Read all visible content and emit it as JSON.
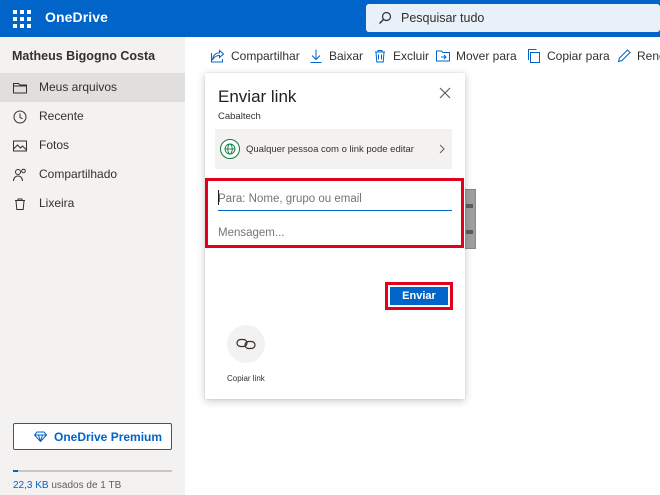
{
  "topbar": {
    "app_name": "OneDrive",
    "search_placeholder": "Pesquisar tudo",
    "brand_color": "#0064c8"
  },
  "sidebar": {
    "user_name": "Matheus Bigogno Costa",
    "items": [
      {
        "label": "Meus arquivos",
        "icon": "folder-icon",
        "active": true
      },
      {
        "label": "Recente",
        "icon": "clock-icon",
        "active": false
      },
      {
        "label": "Fotos",
        "icon": "photo-icon",
        "active": false
      },
      {
        "label": "Compartilhado",
        "icon": "people-icon",
        "active": false
      },
      {
        "label": "Lixeira",
        "icon": "trash-icon",
        "active": false
      }
    ],
    "premium_label": "OneDrive Premium",
    "storage": {
      "used": "22,3 KB",
      "rest": " usados de 1 TB",
      "fraction": 0.03
    }
  },
  "commands": [
    {
      "label": "Compartilhar",
      "icon": "share-icon"
    },
    {
      "label": "Baixar",
      "icon": "download-icon"
    },
    {
      "label": "Excluir",
      "icon": "trash-icon"
    },
    {
      "label": "Mover para",
      "icon": "move-icon"
    },
    {
      "label": "Copiar para",
      "icon": "copy-icon"
    },
    {
      "label": "Reno",
      "icon": "rename-icon"
    }
  ],
  "dialog": {
    "title": "Enviar link",
    "subtitle": "Cabaltech",
    "permission": "Qualquer pessoa com o link pode editar",
    "to_placeholder": "Para: Nome, grupo ou email",
    "message_placeholder": "Mensagem...",
    "send_label": "Enviar",
    "copy_link_label": "Copiar link",
    "highlight_color": "#e3001b"
  }
}
